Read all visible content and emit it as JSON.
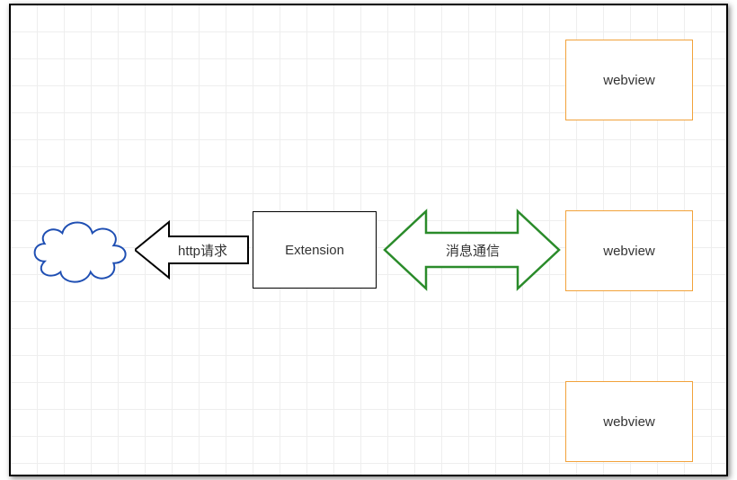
{
  "diagram": {
    "cloud_label": "",
    "extension_label": "Extension",
    "http_arrow_label": "http请求",
    "message_arrow_label": "消息通信",
    "webview_top_label": "webview",
    "webview_mid_label": "webview",
    "webview_bottom_label": "webview",
    "colors": {
      "cloud_stroke": "#1f4fb3",
      "black_stroke": "#000000",
      "green_stroke": "#2a8b2a",
      "orange_stroke": "#f2a23a"
    }
  }
}
